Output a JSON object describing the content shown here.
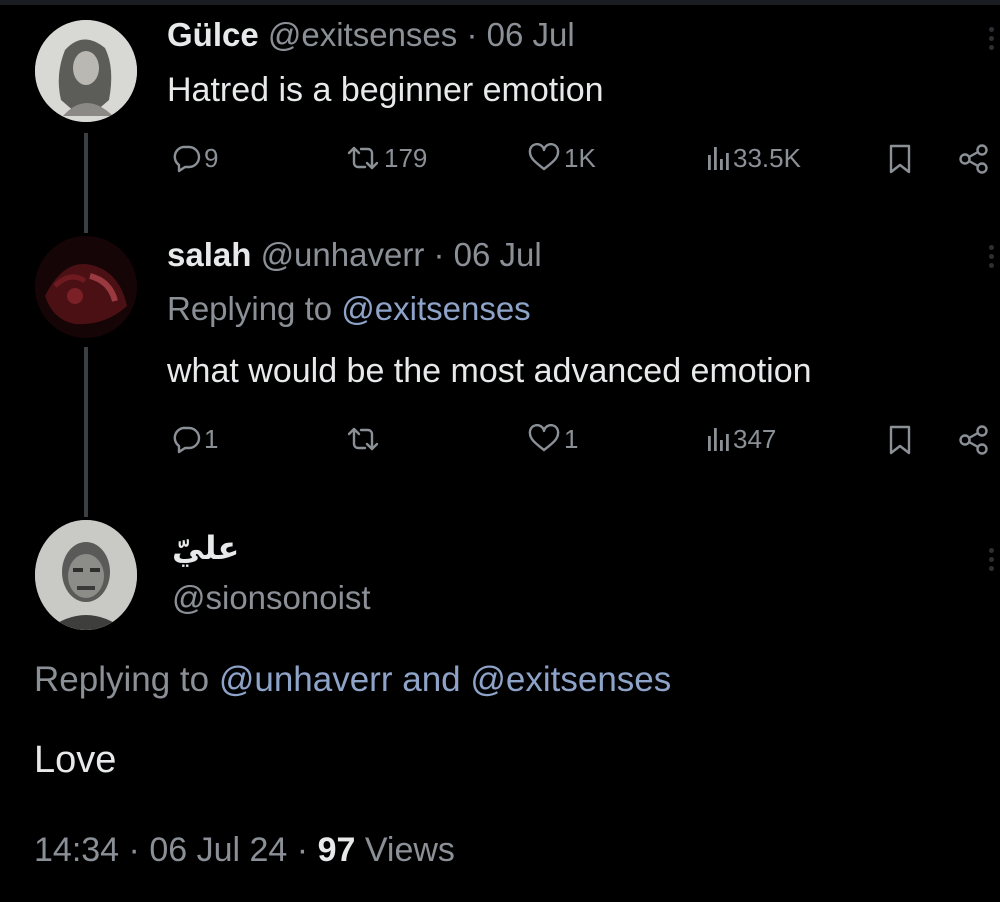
{
  "tweet1": {
    "name": "Gülce",
    "handle": "@exitsenses",
    "sep": "·",
    "date": "06 Jul",
    "text": "Hatred is a beginner emotion",
    "replies": "9",
    "retweets": "179",
    "likes": "1K",
    "views": "33.5K"
  },
  "tweet2": {
    "name": "salah",
    "handle": "@unhaverr",
    "sep": "·",
    "date": "06 Jul",
    "replying_prefix": "Replying to ",
    "replying_to": "@exitsenses",
    "text": "what would be the most advanced emotion",
    "replies": "1",
    "retweets": "",
    "likes": "1",
    "views": "347"
  },
  "tweet3": {
    "name": "عليّ",
    "handle": "@sionsonoist",
    "replying_prefix": "Replying to ",
    "replying_to_1": "@unhaverr",
    "replying_and": " and ",
    "replying_to_2": "@exitsenses",
    "text": "Love",
    "time": "14:34",
    "sep": "·",
    "date": "06 Jul 24",
    "views_count": "97",
    "views_label": "Views"
  },
  "icons": {
    "reply": "reply-icon",
    "retweet": "retweet-icon",
    "like": "heart-icon",
    "views": "views-icon",
    "bookmark": "bookmark-icon",
    "share": "share-icon",
    "more": "more-icon"
  },
  "colors": {
    "background": "#000000",
    "text": "#e7e9ea",
    "muted": "#8b9097",
    "mention": "#8ea3c8"
  }
}
